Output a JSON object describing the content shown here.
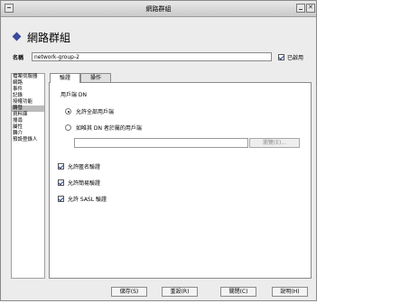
{
  "window": {
    "title": "網路群組"
  },
  "header": {
    "title": "網路群組",
    "icon": "diamond-icon"
  },
  "form": {
    "name_label": "名稱",
    "name_value": "network-group-2",
    "enabled_label": "已啟用",
    "enabled_checked": true
  },
  "sidebar": {
    "items": [
      {
        "label": "檔案伺服器"
      },
      {
        "label": "網路"
      },
      {
        "label": "事件"
      },
      {
        "label": "記錄"
      },
      {
        "label": "授權功能"
      },
      {
        "label": "轉發"
      },
      {
        "label": "資料庫"
      },
      {
        "label": "搜尋"
      },
      {
        "label": "屬性"
      },
      {
        "label": "轉介"
      },
      {
        "label": "預設登錄人"
      }
    ],
    "selected_index": 5
  },
  "tabs": [
    {
      "label": "驗證",
      "active": true
    },
    {
      "label": "操作",
      "active": false
    }
  ],
  "auth": {
    "group_label": "用戶端 DN",
    "radio_all": "允許全部用戶端",
    "radio_tree": "如唯其 DN 者於屬的用戶端",
    "search_button": "瀏覽(E)...",
    "check_anonymous": "允許匿名驗證",
    "check_simple": "允許簡易驗證",
    "check_sasl": "允許 SASL 驗證"
  },
  "buttons": {
    "save": "儲存(S)",
    "reset": "重設(R)",
    "close": "關閉(C)",
    "help": "說明(H)"
  }
}
